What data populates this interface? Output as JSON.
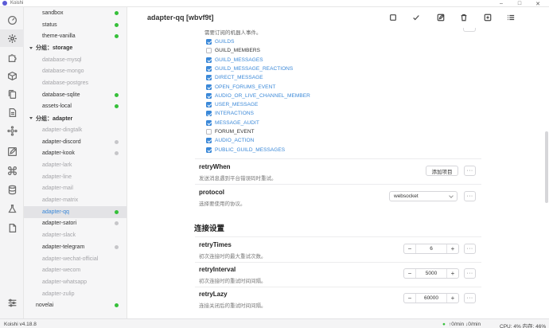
{
  "window": {
    "title": "Koishi"
  },
  "sidebar": {
    "items": [
      {
        "label": "sandbox",
        "type": "plugin",
        "enabled": true,
        "status": "green"
      },
      {
        "label": "status",
        "type": "plugin",
        "enabled": true,
        "status": "green"
      },
      {
        "label": "theme-vanilla",
        "type": "plugin",
        "enabled": true,
        "status": "green"
      },
      {
        "label": "分组：storage",
        "type": "group"
      },
      {
        "label": "database-mysql",
        "type": "plugin",
        "enabled": false
      },
      {
        "label": "database-mongo",
        "type": "plugin",
        "enabled": false
      },
      {
        "label": "database-postgres",
        "type": "plugin",
        "enabled": false
      },
      {
        "label": "database-sqlite",
        "type": "plugin",
        "enabled": true,
        "status": "green"
      },
      {
        "label": "assets-local",
        "type": "plugin",
        "enabled": true,
        "status": "green"
      },
      {
        "label": "分组：adapter",
        "type": "group"
      },
      {
        "label": "adapter-dingtalk",
        "type": "plugin",
        "enabled": false
      },
      {
        "label": "adapter-discord",
        "type": "plugin",
        "enabled": true,
        "status": "grey"
      },
      {
        "label": "adapter-kook",
        "type": "plugin",
        "enabled": true,
        "status": "grey"
      },
      {
        "label": "adapter-lark",
        "type": "plugin",
        "enabled": false
      },
      {
        "label": "adapter-line",
        "type": "plugin",
        "enabled": false
      },
      {
        "label": "adapter-mail",
        "type": "plugin",
        "enabled": false
      },
      {
        "label": "adapter-matrix",
        "type": "plugin",
        "enabled": false
      },
      {
        "label": "adapter-qq",
        "type": "plugin",
        "enabled": true,
        "status": "green",
        "selected": true
      },
      {
        "label": "adapter-satori",
        "type": "plugin",
        "enabled": true,
        "status": "grey"
      },
      {
        "label": "adapter-slack",
        "type": "plugin",
        "enabled": false
      },
      {
        "label": "adapter-telegram",
        "type": "plugin",
        "enabled": true,
        "status": "grey"
      },
      {
        "label": "adapter-wechat-official",
        "type": "plugin",
        "enabled": false
      },
      {
        "label": "adapter-wecom",
        "type": "plugin",
        "enabled": false
      },
      {
        "label": "adapter-whatsapp",
        "type": "plugin",
        "enabled": false
      },
      {
        "label": "adapter-zulip",
        "type": "plugin",
        "enabled": false
      },
      {
        "label": "novelai",
        "type": "plugin",
        "enabled": true,
        "status": "green"
      }
    ]
  },
  "header": {
    "title": "adapter-qq [wbvf9t]",
    "actions": [
      "stop-icon",
      "check-icon",
      "edit-icon",
      "trash-icon",
      "add-plugin-icon",
      "list-icon"
    ]
  },
  "config": {
    "intents_desc": "需要订阅的机器人事件。",
    "intents": [
      {
        "label": "GUILDS",
        "checked": true
      },
      {
        "label": "GUILD_MEMBERS",
        "checked": false
      },
      {
        "label": "GUILD_MESSAGES",
        "checked": true
      },
      {
        "label": "GUILD_MESSAGE_REACTIONS",
        "checked": true
      },
      {
        "label": "DIRECT_MESSAGE",
        "checked": true
      },
      {
        "label": "OPEN_FORUMS_EVENT",
        "checked": true
      },
      {
        "label": "AUDIO_OR_LIVE_CHANNEL_MEMBER",
        "checked": true
      },
      {
        "label": "USER_MESSAGE",
        "checked": true
      },
      {
        "label": "INTERACTIONS",
        "checked": true
      },
      {
        "label": "MESSAGE_AUDIT",
        "checked": true
      },
      {
        "label": "FORUM_EVENT",
        "checked": false
      },
      {
        "label": "AUDIO_ACTION",
        "checked": true
      },
      {
        "label": "PUBLIC_GUILD_MESSAGES",
        "checked": true
      }
    ],
    "retryWhen": {
      "title": "retryWhen",
      "desc": "发送消息遇到平台错误码时重试。",
      "add_label": "添加项目"
    },
    "protocol": {
      "title": "protocol",
      "desc": "选择要使用的协议。",
      "value": "websocket"
    },
    "group_heading": "连接设置",
    "retryTimes": {
      "title": "retryTimes",
      "desc": "初次连接时的最大重试次数。",
      "value": "6"
    },
    "retryInterval": {
      "title": "retryInterval",
      "desc": "初次连接时的重试时间间隔。",
      "value": "5000"
    },
    "retryLazy": {
      "title": "retryLazy",
      "desc": "连接关闭后的重试时间间隔。",
      "value": "60000"
    },
    "more_label": "···"
  },
  "statusbar": {
    "version": "Koishi v4.18.8",
    "network": "↑0/min ↓0/min",
    "cpu": "CPU: 4% 内存: 46%"
  },
  "colors": {
    "accent": "#3a88d8",
    "status_ok": "#35c03a",
    "status_idle": "#c6c6c9"
  }
}
